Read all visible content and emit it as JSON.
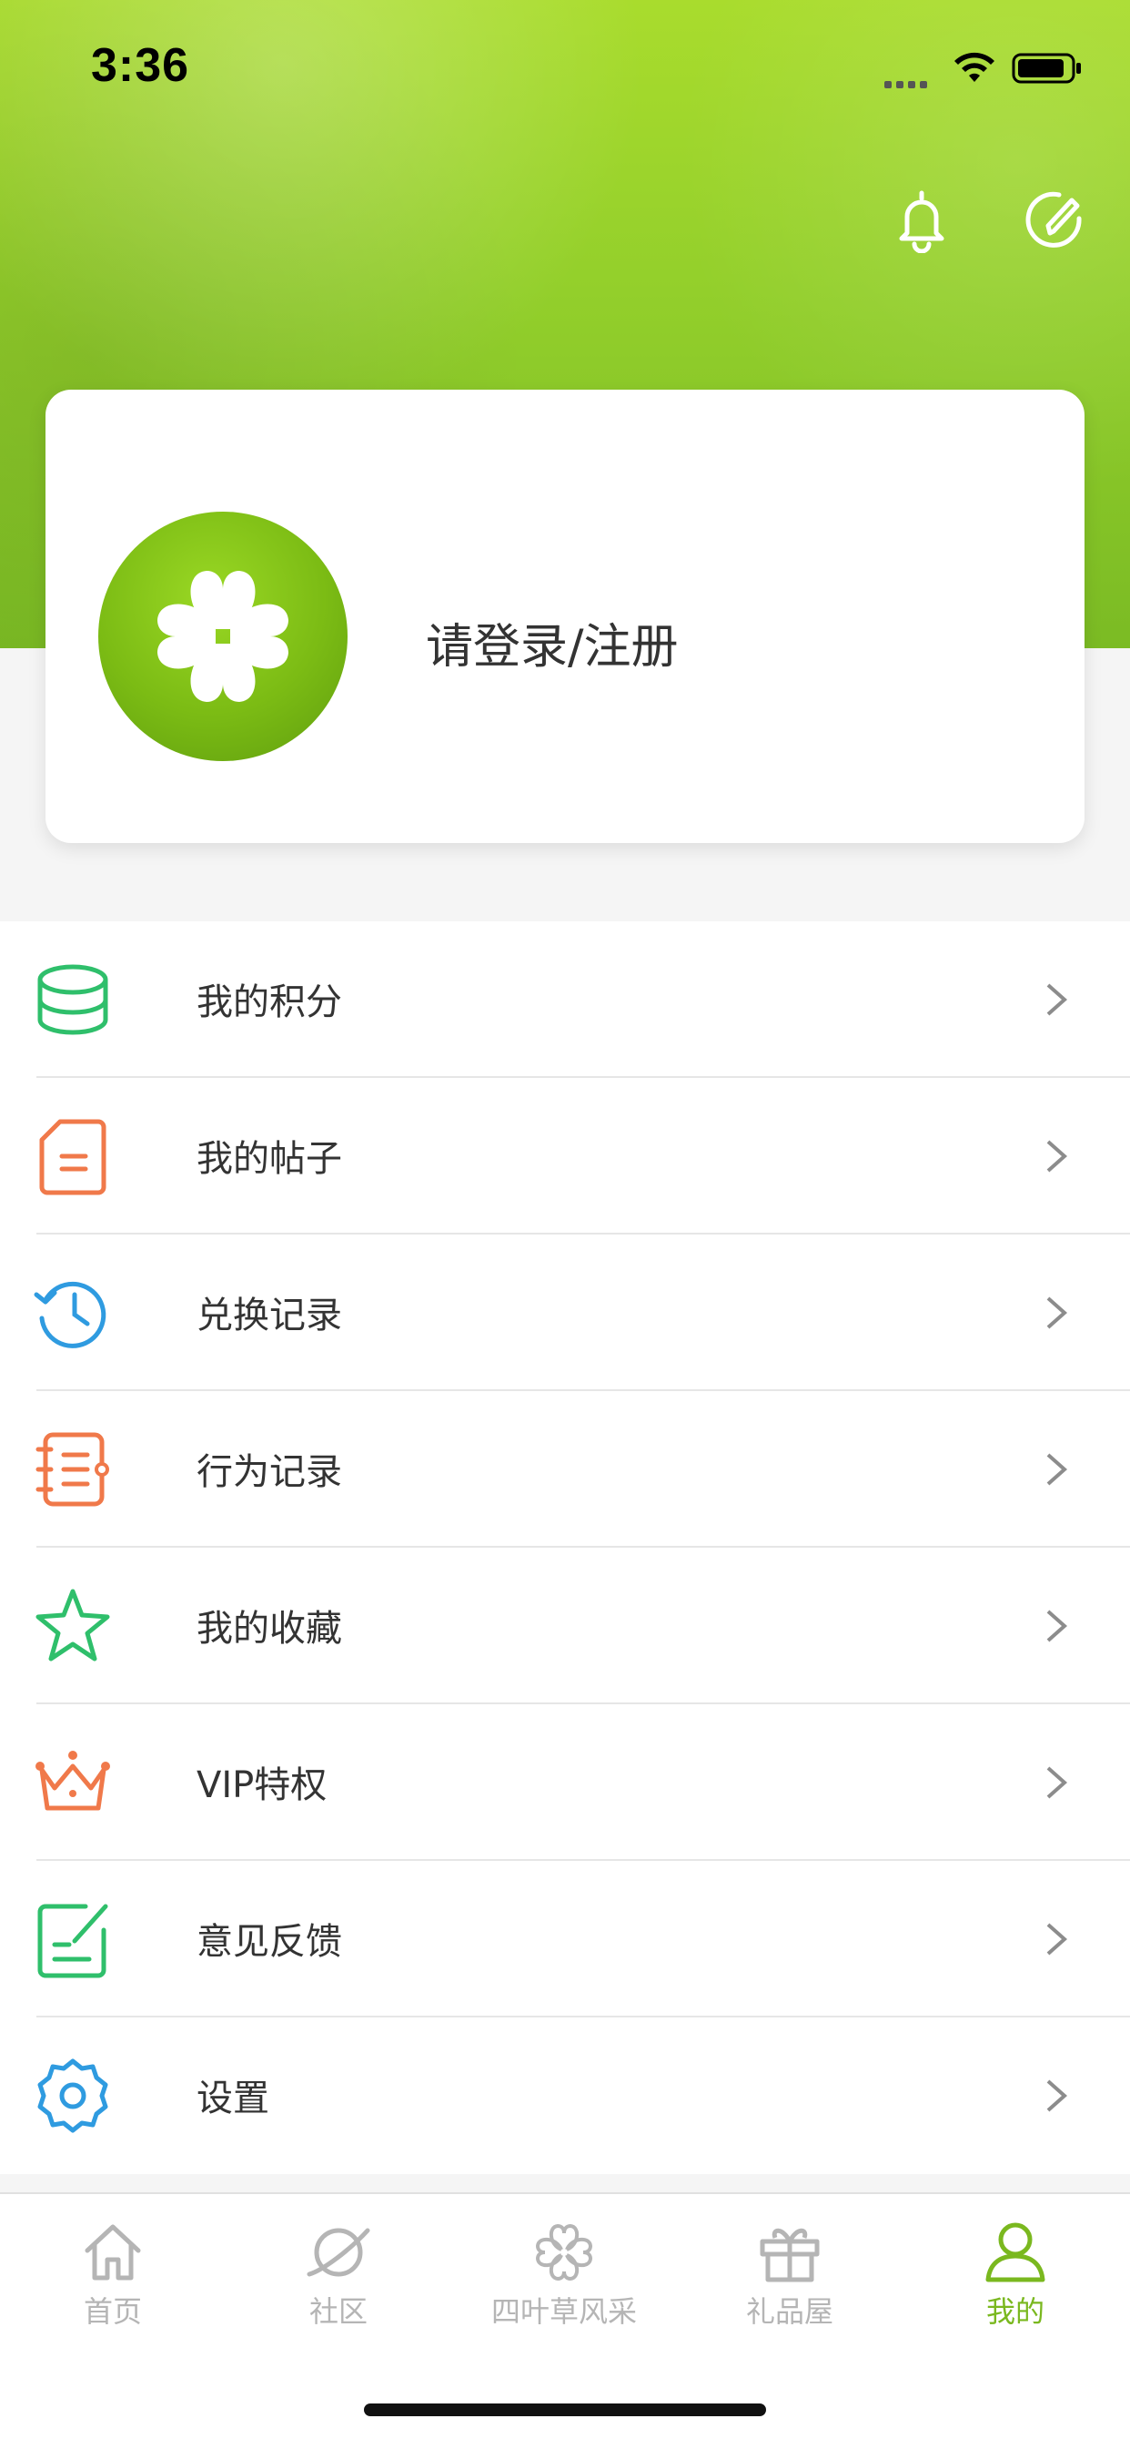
{
  "status_bar": {
    "time": "3:36"
  },
  "profile": {
    "login_label": "请登录/注册"
  },
  "menu": {
    "items": [
      {
        "label": "我的积分",
        "icon": "coins-stack-icon"
      },
      {
        "label": "我的帖子",
        "icon": "document-icon"
      },
      {
        "label": "兑换记录",
        "icon": "history-clock-icon"
      },
      {
        "label": "行为记录",
        "icon": "notebook-icon"
      },
      {
        "label": "我的收藏",
        "icon": "star-icon"
      },
      {
        "label": "VIP特权",
        "icon": "crown-icon"
      },
      {
        "label": "意见反馈",
        "icon": "feedback-edit-icon"
      },
      {
        "label": "设置",
        "icon": "gear-icon"
      }
    ]
  },
  "tabbar": {
    "tabs": [
      {
        "label": "首页",
        "icon": "home-icon",
        "active": false
      },
      {
        "label": "社区",
        "icon": "planet-icon",
        "active": false
      },
      {
        "label": "四叶草风采",
        "icon": "clover-icon",
        "active": false
      },
      {
        "label": "礼品屋",
        "icon": "gift-icon",
        "active": false
      },
      {
        "label": "我的",
        "icon": "person-icon",
        "active": true
      }
    ]
  },
  "colors": {
    "brand_green": "#7ab81f",
    "icon_green": "#2fbf6b",
    "icon_orange": "#f0794a",
    "icon_blue": "#2f9be0",
    "inactive_gray": "#b5b5b5"
  }
}
